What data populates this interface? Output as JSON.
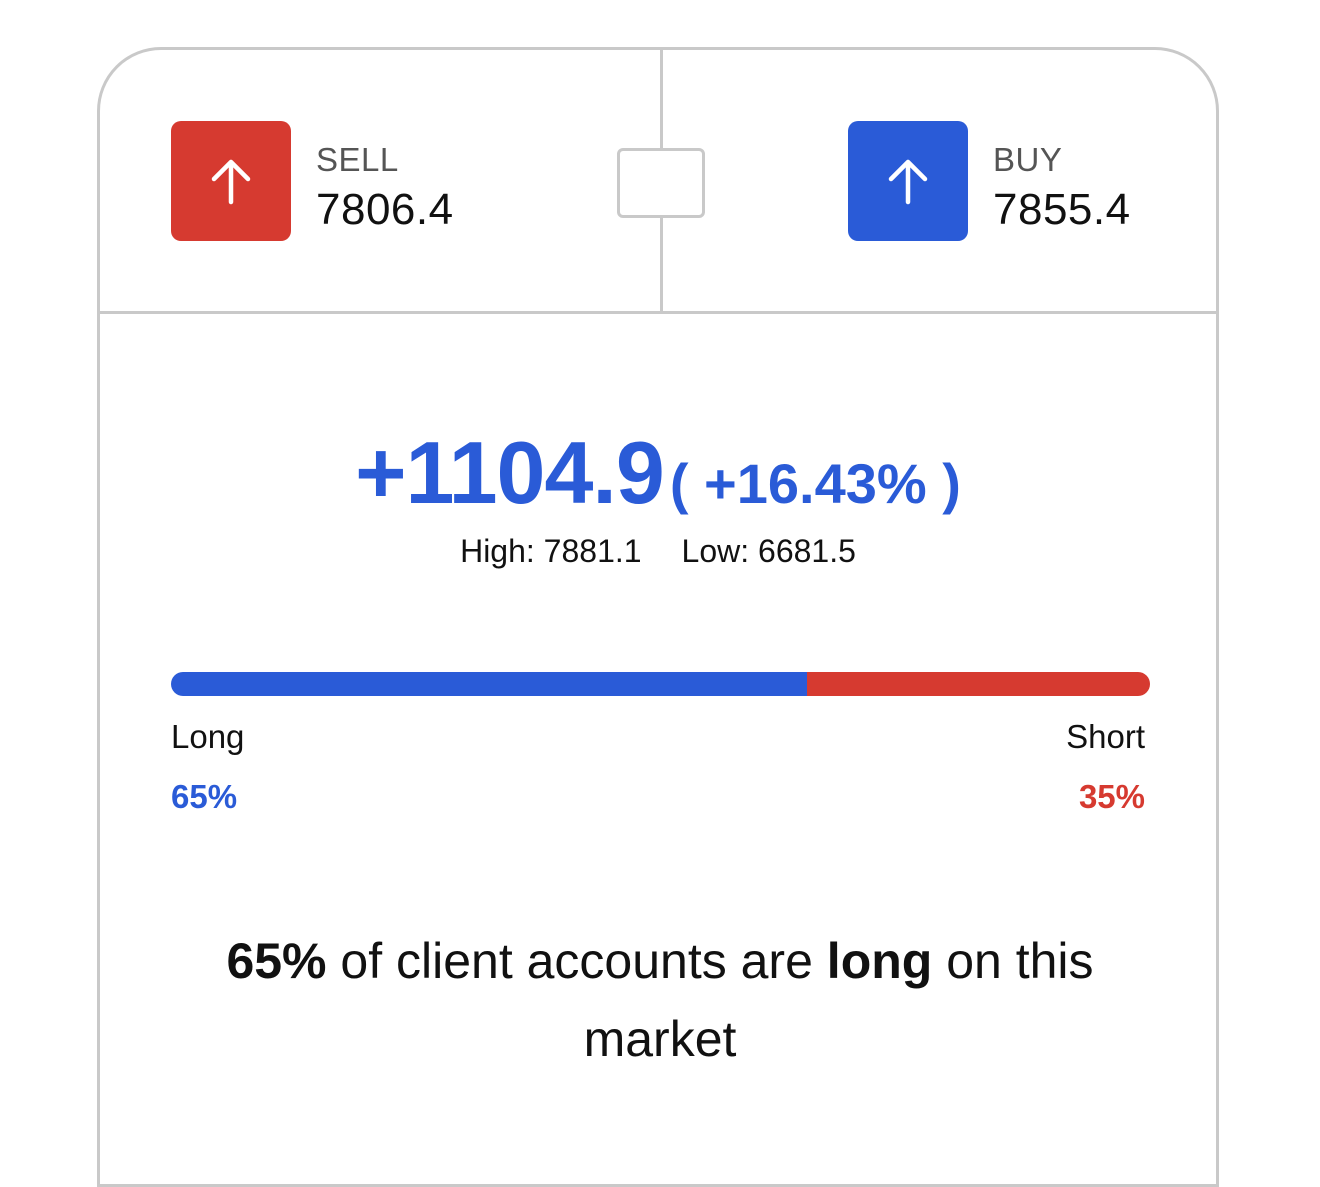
{
  "sell": {
    "label": "SELL",
    "price": "7806.4",
    "icon": "arrow-up-icon",
    "color": "#d63a30"
  },
  "buy": {
    "label": "BUY",
    "price": "7855.4",
    "icon": "arrow-up-icon",
    "color": "#2a5bd7"
  },
  "change": {
    "value": "+1104.9",
    "percent": "( +16.43% )",
    "color": "#2a5bd7"
  },
  "range": {
    "high": "High: 7881.1",
    "low": "Low: 6681.5"
  },
  "sentiment": {
    "long_label": "Long",
    "short_label": "Short",
    "long_pct_text": "65%",
    "short_pct_text": "35%",
    "long_fraction": 0.65,
    "long_color": "#2a5bd7",
    "short_color": "#d63a30"
  },
  "summary": {
    "pct": "65%",
    "text_before": " of client accounts are ",
    "emphasis": "long",
    "text_after": " on this market"
  }
}
